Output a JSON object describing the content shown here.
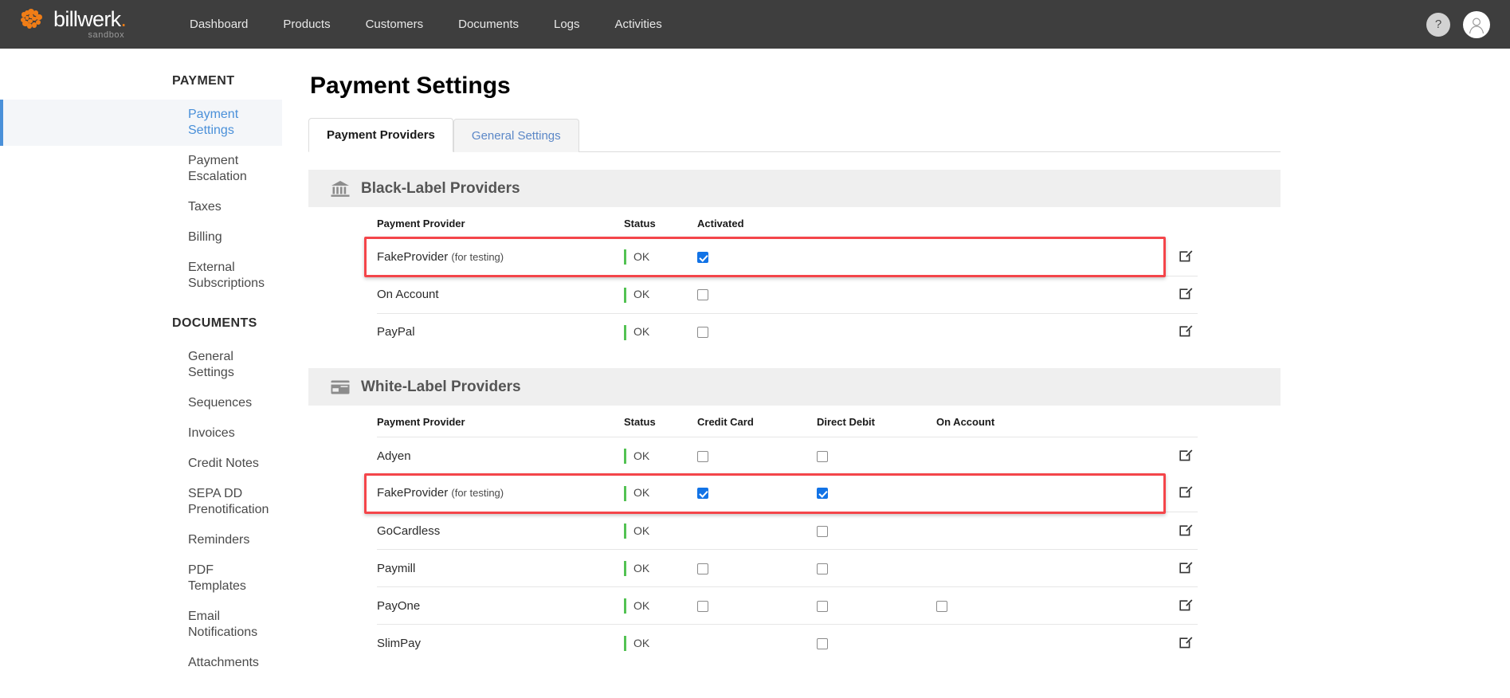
{
  "brand": {
    "name": "billwerk",
    "dot": ".",
    "sub": "sandbox",
    "logo_color": "#f07d16",
    "header_bg": "#3e3e3e"
  },
  "topnav": {
    "items": [
      {
        "label": "Dashboard"
      },
      {
        "label": "Products"
      },
      {
        "label": "Customers"
      },
      {
        "label": "Documents"
      },
      {
        "label": "Logs"
      },
      {
        "label": "Activities"
      }
    ],
    "help_label": "?",
    "avatar_label": "user-avatar"
  },
  "sidebar": {
    "sections": [
      {
        "title": "PAYMENT",
        "items": [
          {
            "label": "Payment Settings",
            "active": true
          },
          {
            "label": "Payment Escalation",
            "active": false
          },
          {
            "label": "Taxes",
            "active": false
          },
          {
            "label": "Billing",
            "active": false
          },
          {
            "label": "External Subscriptions",
            "active": false
          }
        ]
      },
      {
        "title": "DOCUMENTS",
        "items": [
          {
            "label": "General Settings",
            "active": false
          },
          {
            "label": "Sequences",
            "active": false
          },
          {
            "label": "Invoices",
            "active": false
          },
          {
            "label": "Credit Notes",
            "active": false
          },
          {
            "label": "SEPA DD Prenotification",
            "active": false
          },
          {
            "label": "Reminders",
            "active": false
          },
          {
            "label": "PDF Templates",
            "active": false
          },
          {
            "label": "Email Notifications",
            "active": false
          },
          {
            "label": "Attachments",
            "active": false
          }
        ]
      }
    ]
  },
  "main": {
    "page_title": "Payment Settings",
    "tabs": [
      {
        "label": "Payment Providers",
        "active": true
      },
      {
        "label": "General Settings",
        "active": false
      }
    ]
  },
  "black_label": {
    "section_title": "Black-Label Providers",
    "icon": "bank-icon",
    "columns": [
      "Payment Provider",
      "Status",
      "Activated"
    ],
    "rows": [
      {
        "name": "FakeProvider",
        "note": "(for testing)",
        "status": "OK",
        "activated": true,
        "highlighted": true,
        "edit": "edit-icon"
      },
      {
        "name": "On Account",
        "note": "",
        "status": "OK",
        "activated": false,
        "highlighted": false,
        "edit": "edit-icon"
      },
      {
        "name": "PayPal",
        "note": "",
        "status": "OK",
        "activated": false,
        "highlighted": false,
        "edit": "edit-icon"
      }
    ]
  },
  "white_label": {
    "section_title": "White-Label Providers",
    "icon": "credit-card-icon",
    "columns": [
      "Payment Provider",
      "Status",
      "Credit Card",
      "Direct Debit",
      "On Account"
    ],
    "rows": [
      {
        "name": "Adyen",
        "note": "",
        "status": "OK",
        "credit_card": false,
        "credit_card_present": true,
        "direct_debit": false,
        "direct_debit_present": true,
        "on_account": false,
        "on_account_present": false,
        "highlighted": false,
        "edit": "edit-icon"
      },
      {
        "name": "FakeProvider",
        "note": "(for testing)",
        "status": "OK",
        "credit_card": true,
        "credit_card_present": true,
        "direct_debit": true,
        "direct_debit_present": true,
        "on_account": false,
        "on_account_present": false,
        "highlighted": true,
        "edit": "edit-icon"
      },
      {
        "name": "GoCardless",
        "note": "",
        "status": "OK",
        "credit_card": false,
        "credit_card_present": false,
        "direct_debit": false,
        "direct_debit_present": true,
        "on_account": false,
        "on_account_present": false,
        "highlighted": false,
        "edit": "edit-icon"
      },
      {
        "name": "Paymill",
        "note": "",
        "status": "OK",
        "credit_card": false,
        "credit_card_present": true,
        "direct_debit": false,
        "direct_debit_present": true,
        "on_account": false,
        "on_account_present": false,
        "highlighted": false,
        "edit": "edit-icon"
      },
      {
        "name": "PayOne",
        "note": "",
        "status": "OK",
        "credit_card": false,
        "credit_card_present": true,
        "direct_debit": false,
        "direct_debit_present": true,
        "on_account": false,
        "on_account_present": true,
        "highlighted": false,
        "edit": "edit-icon"
      },
      {
        "name": "SlimPay",
        "note": "",
        "status": "OK",
        "credit_card": false,
        "credit_card_present": false,
        "direct_debit": false,
        "direct_debit_present": true,
        "on_account": false,
        "on_account_present": false,
        "highlighted": false,
        "edit": "edit-icon"
      }
    ]
  },
  "colors": {
    "accent_blue": "#4a90d9",
    "checkbox_blue": "#1273e6",
    "status_green": "#53c253",
    "highlight_red": "#f4454a"
  }
}
